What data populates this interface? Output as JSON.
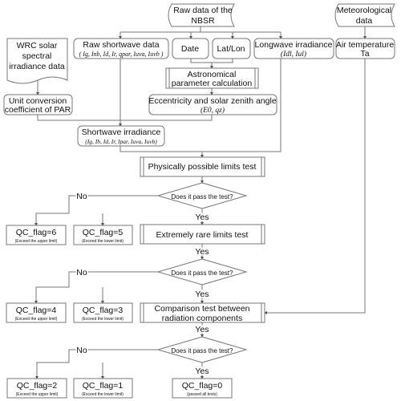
{
  "nodes": {
    "nbsr": [
      "Raw data of the",
      "NBSR"
    ],
    "meteo": [
      "Meteorological",
      "data"
    ],
    "wrc": [
      "WRC solar",
      "spectral",
      "irradiance data"
    ],
    "raw_sw": [
      "Raw shortwave data",
      "( Ig, Inb, Id, Ir, qpar, Iuva, Iuvb )"
    ],
    "date": "Date",
    "latlon": "Lat/Lon",
    "longwave": [
      "Longwave irradiance",
      "(Idl, Iul)"
    ],
    "air_temp": [
      "Air temperature",
      "Ta"
    ],
    "astro": [
      "Astronomical",
      "parameter calculation"
    ],
    "ecc": [
      "Eccentricity and solar zenith angle",
      "(E0, qz)"
    ],
    "unit_conv": [
      "Unit conversion",
      "coefficient of PAR"
    ],
    "sw_irr": [
      "Shortwave irradiance",
      "(Ig, Ib, Id, Ir, Ipar, Iuva, Iuvb)"
    ],
    "test1": "Physically possible limits test",
    "test2": "Extremely rare limits test",
    "test3": [
      "Comparison test between",
      "radiation components"
    ],
    "decision": "Does it pass the test?",
    "yes": "Yes",
    "no": "No",
    "flags": [
      {
        "label": "QC_flag=6",
        "note": "(Exceed the upper limit)"
      },
      {
        "label": "QC_flag=5",
        "note": "(Exceed the lower limit)"
      },
      {
        "label": "QC_flag=4",
        "note": "(Exceed the upper limit)"
      },
      {
        "label": "QC_flag=3",
        "note": "(Exceed the lower limit)"
      },
      {
        "label": "QC_flag=2",
        "note": "(Exceed the upper limit)"
      },
      {
        "label": "QC_flag=1",
        "note": "(Exceed the lower limit)"
      },
      {
        "label": "QC_flag=0",
        "note": "(passed all tests)"
      }
    ]
  }
}
